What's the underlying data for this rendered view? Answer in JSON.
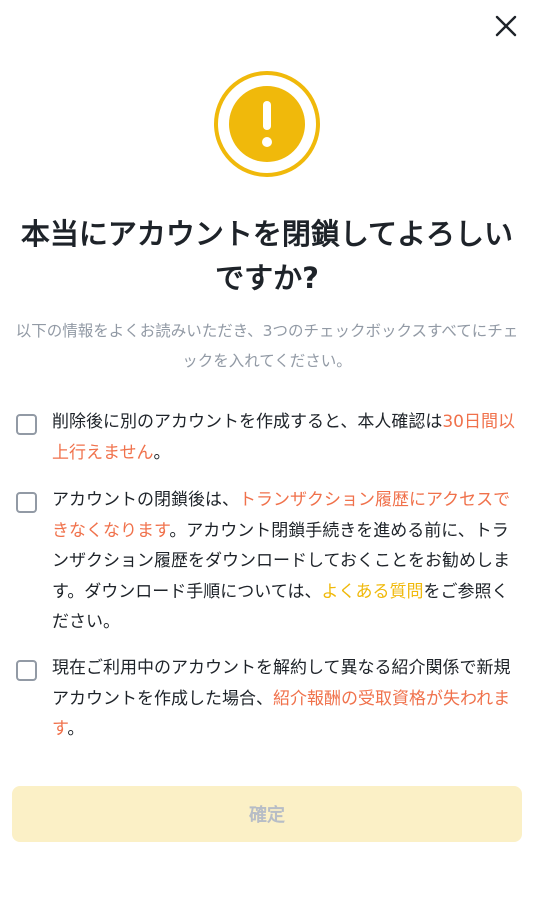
{
  "dialog": {
    "close_icon": "close-icon",
    "warning_icon": "exclamation-icon",
    "title": "本当にアカウントを閉鎖してよろしいですか?",
    "subtitle": "以下の情報をよくお読みいただき、3つのチェックボックスすべてにチェックを入れてください。",
    "checks": [
      {
        "checked": false,
        "parts": [
          "削除後に別のアカウントを作成すると、本人確認は",
          "30日間以上行えません",
          "。"
        ]
      },
      {
        "checked": false,
        "parts": [
          "アカウントの閉鎖後は、",
          "トランザクション履歴にアクセスできなくなります",
          "。アカウント閉鎖手続きを進める前に、トランザクション履歴をダウンロードしておくことをお勧めします。ダウンロード手順については、",
          "よくある質問",
          "をご参照ください。"
        ]
      },
      {
        "checked": false,
        "parts": [
          "現在ご利用中のアカウントを解約して異なる紹介関係で新規アカウントを作成した場合、",
          "紹介報酬の受取資格が失われます",
          "。"
        ]
      }
    ],
    "confirm_label": "確定",
    "colors": {
      "accent": "#f0b90b",
      "highlight": "#f0714b",
      "muted": "#929aa5",
      "disabled_button_bg": "#fbf0c6"
    }
  }
}
